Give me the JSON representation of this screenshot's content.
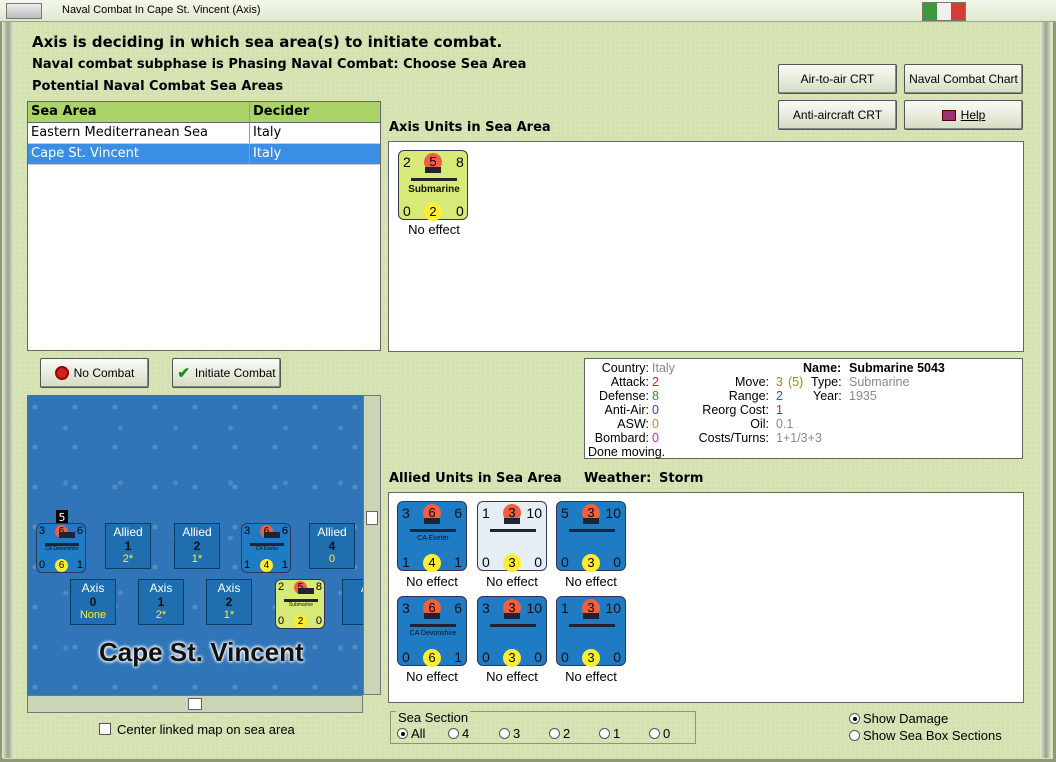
{
  "window": {
    "title": "Naval Combat In Cape St. Vincent (Axis)",
    "flag_colors": [
      "#3c9a3c",
      "#f0f0f0",
      "#d83a3a"
    ]
  },
  "header": {
    "line1": "Axis is deciding in which sea area(s) to initiate combat.",
    "line2": "Naval combat subphase is Phasing Naval Combat: Choose Sea Area",
    "line3": "Potential Naval Combat Sea Areas"
  },
  "buttons": {
    "air_to_air": "Air-to-air CRT",
    "naval_chart": "Naval Combat Chart",
    "anti_aircraft": "Anti-aircraft CRT",
    "help": "Help",
    "no_combat": "No Combat",
    "initiate": "Initiate Combat"
  },
  "sea_table": {
    "headers": [
      "Sea Area",
      "Decider"
    ],
    "rows": [
      [
        "Eastern Mediterranean Sea",
        "Italy"
      ],
      [
        "Cape St. Vincent",
        "Italy"
      ]
    ]
  },
  "axis_panel": {
    "label": "Axis Units in Sea Area",
    "unit": {
      "tl": "2",
      "tm": "5",
      "tr": "8",
      "bl": "0",
      "bm": "2",
      "br": "0",
      "name": "Submarine",
      "effect": "No effect"
    }
  },
  "info": {
    "labels": {
      "country": "Country:",
      "attack": "Attack:",
      "defense": "Defense:",
      "anti_air": "Anti-Air:",
      "asw": "ASW:",
      "bombard": "Bombard:",
      "name": "Name:",
      "move": "Move:",
      "type": "Type:",
      "range": "Range:",
      "year": "Year:",
      "reorg": "Reorg Cost:",
      "oil": "Oil:",
      "costs": "Costs/Turns:"
    },
    "country": "Italy",
    "attack": "2",
    "defense": "8",
    "anti_air": "0",
    "asw": "0",
    "bombard": "0",
    "name": "Submarine 5043",
    "move": "3",
    "move_extra": "(5)",
    "type": "Submarine",
    "range": "2",
    "year": "1935",
    "reorg": "1",
    "oil": "0.1",
    "costs": "1+1/3+3",
    "status": "Done moving."
  },
  "allied_panel": {
    "label": "Allied Units in Sea Area",
    "weather_label": "Weather:",
    "weather": "Storm",
    "units": [
      {
        "tl": "3",
        "tm": "6",
        "tr": "6",
        "bl": "1",
        "bm": "4",
        "br": "1",
        "name": "CA Exeter",
        "effect": "No effect"
      },
      {
        "tl": "1",
        "tm": "3",
        "tr": "10",
        "bl": "0",
        "bm": "3",
        "br": "0",
        "name": "",
        "effect": "No effect"
      },
      {
        "tl": "5",
        "tm": "3",
        "tr": "10",
        "bl": "0",
        "bm": "3",
        "br": "0",
        "name": "",
        "effect": "No effect"
      },
      {
        "tl": "3",
        "tm": "6",
        "tr": "6",
        "bl": "0",
        "bm": "6",
        "br": "1",
        "name": "CA Devonshire",
        "effect": "No effect"
      },
      {
        "tl": "3",
        "tm": "3",
        "tr": "10",
        "bl": "0",
        "bm": "3",
        "br": "0",
        "name": "",
        "effect": "No effect"
      },
      {
        "tl": "1",
        "tm": "3",
        "tr": "10",
        "bl": "0",
        "bm": "3",
        "br": "0",
        "name": "",
        "effect": "No effect"
      }
    ]
  },
  "map": {
    "title": "Cape St. Vincent",
    "stack_count": "5",
    "allied_boxes": [
      {
        "side": "Allied",
        "n": "1",
        "sub": "2*"
      },
      {
        "side": "Allied",
        "n": "2",
        "sub": "1*"
      },
      {
        "side": "Allied",
        "n": "4",
        "sub": "0"
      }
    ],
    "axis_boxes": [
      {
        "side": "Axis",
        "n": "0",
        "sub": "None"
      },
      {
        "side": "Axis",
        "n": "1",
        "sub": "2*"
      },
      {
        "side": "Axis",
        "n": "2",
        "sub": "1*"
      },
      {
        "side": "A",
        "n": "",
        "sub": ""
      }
    ],
    "map_units": [
      {
        "tl": "3",
        "tm": "6",
        "tr": "6",
        "bl": "0",
        "bm": "6",
        "br": "1",
        "name": "CA Devonshire"
      },
      {
        "tl": "3",
        "tm": "6",
        "tr": "6",
        "bl": "1",
        "bm": "4",
        "br": "1",
        "name": "CA Exeter"
      },
      {
        "tl": "2",
        "tm": "5",
        "tr": "8",
        "bl": "0",
        "bm": "2",
        "br": "0",
        "name": "Submarine"
      }
    ]
  },
  "options": {
    "center_map": "Center linked map on sea area",
    "show_damage": "Show Damage",
    "show_sea_box": "Show Sea Box Sections"
  },
  "sea_section": {
    "legend": "Sea Section",
    "options": [
      "All",
      "4",
      "3",
      "2",
      "1",
      "0"
    ],
    "selected": "All"
  }
}
